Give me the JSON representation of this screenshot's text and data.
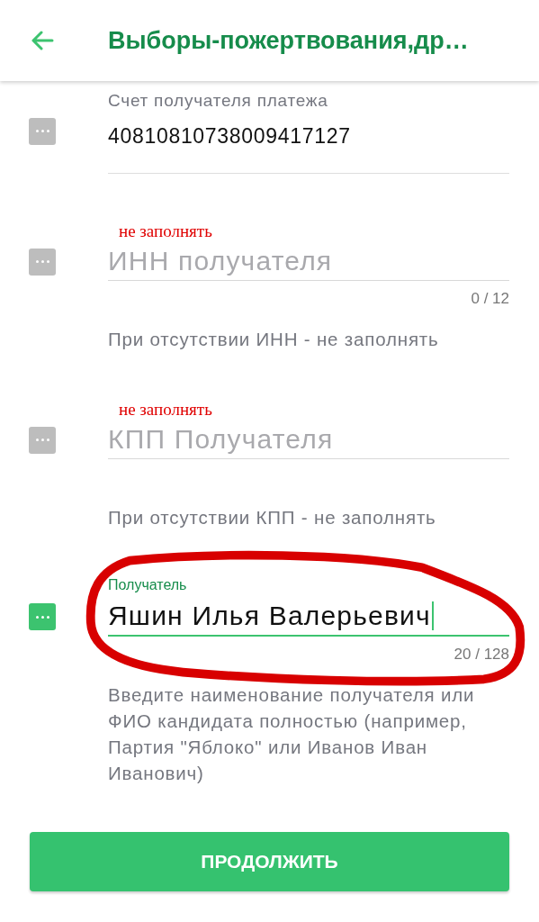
{
  "header": {
    "title": "Выборы-пожертвования,др…"
  },
  "fields": [
    {
      "kind": "value",
      "label": "Счет получателя платежа",
      "value": "40810810738009417127",
      "active": false,
      "circled": false
    },
    {
      "kind": "input",
      "annotation": "не заполнять",
      "placeholder": "ИНН получателя",
      "counter": "0 / 12",
      "helper": "При отсутствии ИНН - не заполнять",
      "active": false,
      "circled": false
    },
    {
      "kind": "input",
      "annotation": "не заполнять",
      "placeholder": "КПП Получателя",
      "helper": "При отсутствии КПП - не заполнять",
      "active": false,
      "circled": false
    },
    {
      "kind": "input",
      "label": "Получатель",
      "value": "Яшин Илья Валерьевич",
      "counter": "20 / 128",
      "helper": "Введите наименование получателя или ФИО кандидата полностью (например, Партия \"Яблоко\" или Иванов Иван Иванович)",
      "active": true,
      "circled": true
    }
  ],
  "button": {
    "label": "ПРОДОЛЖИТЬ"
  }
}
